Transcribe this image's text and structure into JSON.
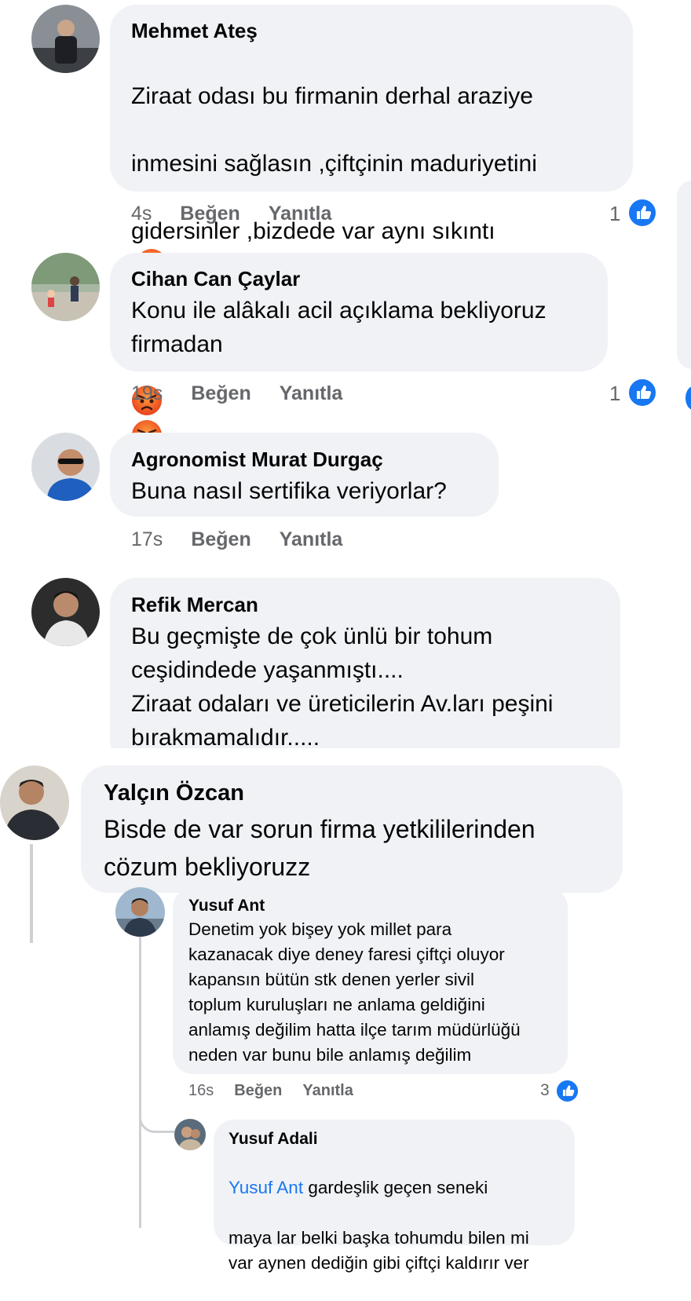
{
  "comments": [
    {
      "author": "Mehmet Ateş",
      "text_line1": "Ziraat odası bu firmanin  derhal araziye",
      "text_line2": "inmesini sağlasın ,çiftçinin maduriyetini",
      "text_line3": "gidersinler ,bizdede var aynı sıkıntı",
      "emoji": "angry-face",
      "time": "4s",
      "like_label": "Beğen",
      "reply_label": "Yanıtla",
      "reactions": "1"
    },
    {
      "author": "Cihan Can Çaylar",
      "text": "Konu ile alâkalı acil açıklama bekliyoruz\nfirmadan",
      "time": "19s",
      "like_label": "Beğen",
      "reply_label": "Yanıtla",
      "reactions": "1"
    },
    {
      "author": "Agronomist Murat Durgaç",
      "text": "Buna nasıl sertifika veriyorlar?",
      "time": "17s",
      "like_label": "Beğen",
      "reply_label": "Yanıtla"
    },
    {
      "author": "Refik Mercan",
      "text": "Bu geçmişte de  çok ünlü bir tohum\nceşidindede yaşanmıştı....\nZiraat odaları ve üreticilerin Av.ları peşini\nbırakmamalıdır....."
    },
    {
      "author": "Yalçın Özcan",
      "text": "Bisde de var sorun firma yetkililerinden\ncözum bekliyoruzz"
    }
  ],
  "replies": [
    {
      "author": "Yusuf Ant",
      "text": "Denetim yok bişey yok millet para\nkazanacak diye deney faresi çiftçi oluyor\nkapansın bütün stk denen yerler sivil\ntoplum kuruluşları ne anlama geldiğini\nanlamış değilim hatta ilçe tarım müdürlüğü\nneden var bunu bile anlamış değilim",
      "time": "16s",
      "like_label": "Beğen",
      "reply_label": "Yanıtla",
      "reactions": "3"
    },
    {
      "author": "Yusuf Adali",
      "mention": "Yusuf Ant",
      "text_first": " gardeşlik geçen seneki",
      "text_rest": "maya lar belki başka tohumdu bilen mi\nvar aynen dediğin gibi çiftçi kaldırır ver"
    }
  ],
  "colors": {
    "bubble": "#f0f2f5",
    "like_blue": "#1877f2",
    "meta_gray": "#65676b"
  }
}
